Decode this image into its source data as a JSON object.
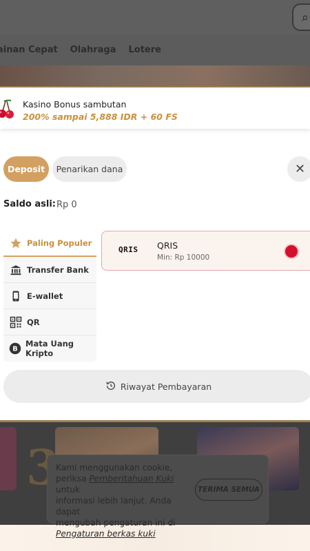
{
  "background": {
    "nav_items": [
      "ainan Cepat",
      "Olahraga",
      "Lotere"
    ],
    "game_number": "3"
  },
  "bonus": {
    "title": "Kasino Bonus sambutan",
    "subtitle": "200% sampai 5,888 IDR + 60 FS",
    "icon": "cherry-icon"
  },
  "tabs": {
    "deposit": "Deposit",
    "withdraw": "Penarikan dana"
  },
  "balance": {
    "label": "Saldo asli:",
    "value": "Rp 0"
  },
  "methods": [
    {
      "label": "Paling Populer",
      "icon": "star-icon"
    },
    {
      "label": "Transfer Bank",
      "icon": "bank-icon"
    },
    {
      "label": "E-wallet",
      "icon": "wallet-icon"
    },
    {
      "label": "QR",
      "icon": "qr-icon"
    },
    {
      "label": "Mata Uang Kripto",
      "icon": "bitcoin-icon"
    }
  ],
  "payment_option": {
    "logo_text": "QRIS",
    "name": "QRIS",
    "min": "Min: Rp 10000"
  },
  "history_button": "Riwayat Pembayaran",
  "cookie": {
    "line1": "Kami menggunakan cookie,",
    "line2_pre": "periksa ",
    "line2_link": "Pemberitahuan Kuki",
    "line2_post": " untuk",
    "line3": "informasi lebih lanjut. Anda dapat",
    "line4": "mengubah pengaturan ini di",
    "line5_link": "Pengaturan berkas kuki",
    "accept": "TERIMA SEMUA"
  },
  "colors": {
    "accent_gold": "#d3a061",
    "bonus_text": "#c8913e",
    "radio_selected": "#d2102d"
  }
}
